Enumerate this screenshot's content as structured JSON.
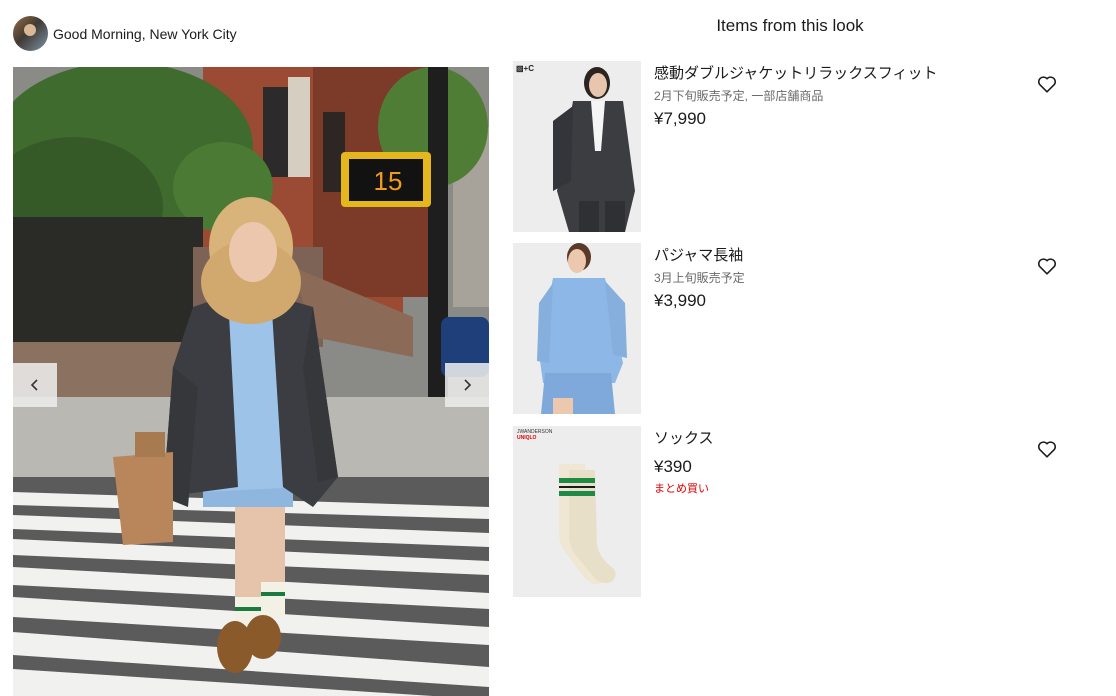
{
  "header": {
    "profile_name": "Good Morning, New York City",
    "section_title": "Items from this look"
  },
  "photo": {
    "prev_icon": "chevron-left-icon",
    "next_icon": "chevron-right-icon",
    "signal_number": "15"
  },
  "items": [
    {
      "brand": "▧+C",
      "name": "感動ダブルジャケットリラックスフィット",
      "note": "2月下旬販売予定, 一部店舗商品",
      "price": "¥7,990",
      "fav_icon": "heart-icon"
    },
    {
      "name": "パジャマ長袖",
      "note": "3月上旬販売予定",
      "price": "¥3,990",
      "fav_icon": "heart-icon"
    },
    {
      "brand": "JWANDERSON",
      "brand_badge": "UNIQLO",
      "name": "ソックス",
      "price": "¥390",
      "promo": "まとめ買い",
      "fav_icon": "heart-icon"
    }
  ],
  "colors": {
    "promo": "#e10000",
    "text": "#1b1b1b",
    "muted": "#6a6a6a"
  }
}
